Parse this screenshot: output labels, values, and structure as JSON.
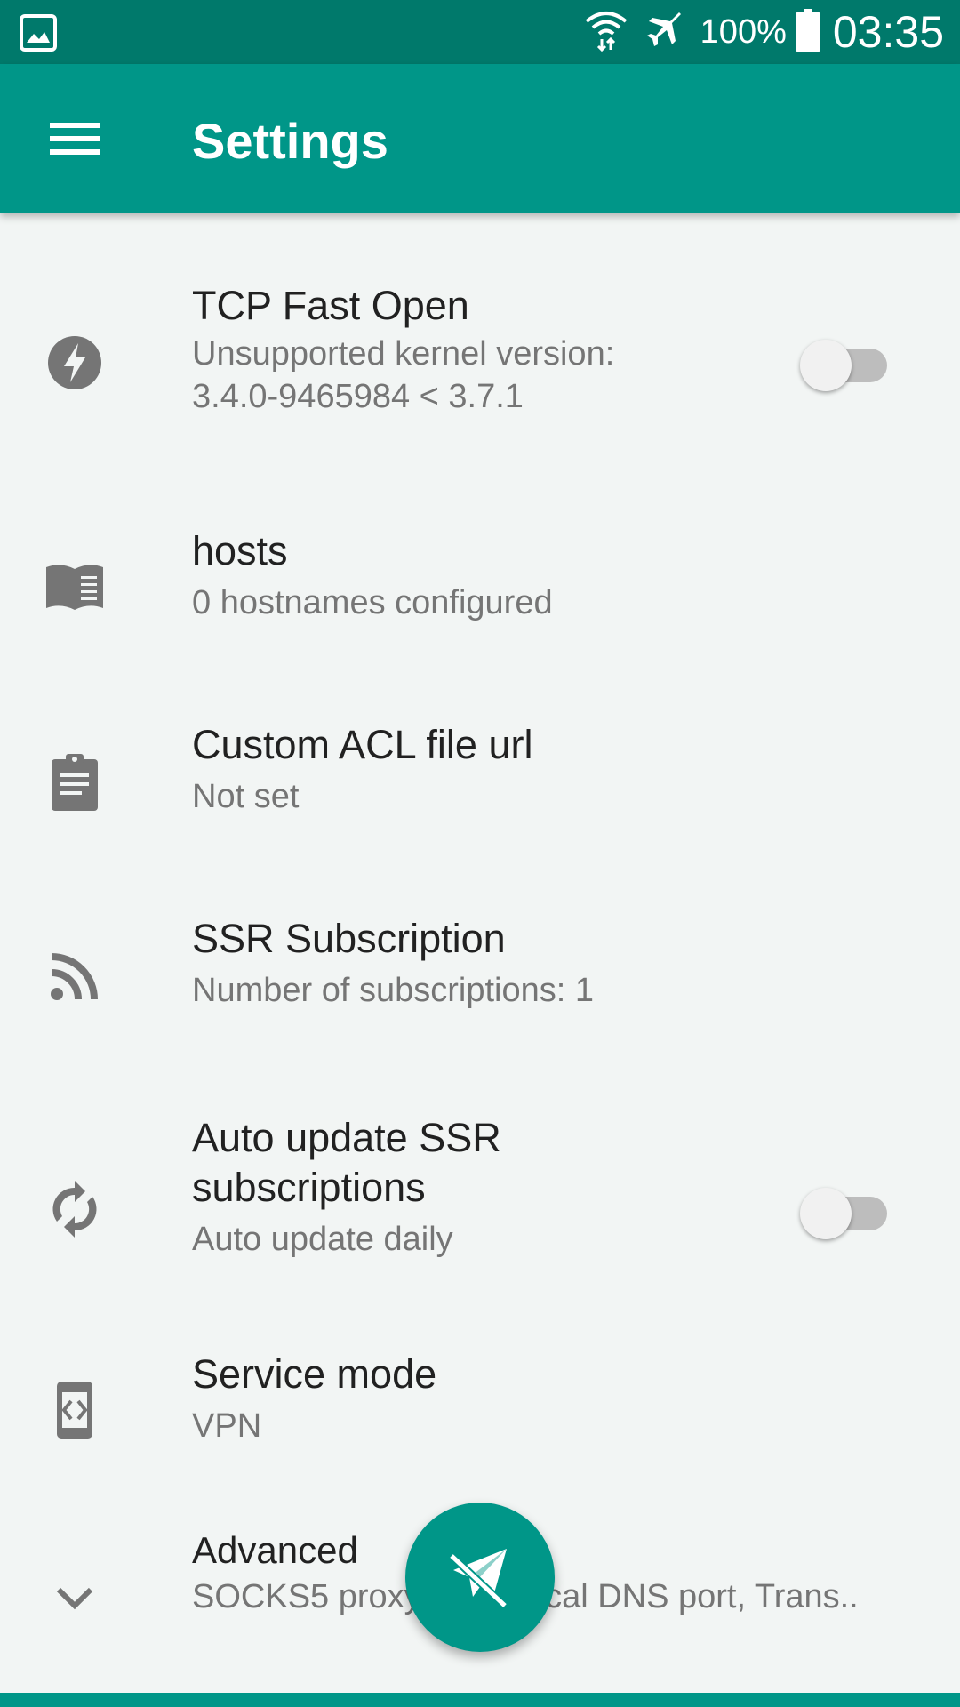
{
  "status_bar": {
    "battery": "100%",
    "time": "03:35",
    "icons": [
      "image-icon",
      "wifi-icon",
      "airplane-icon",
      "battery-icon"
    ]
  },
  "app_bar": {
    "title": "Settings",
    "menu_icon": "menu-icon"
  },
  "settings": {
    "tcp_fast_open": {
      "title": "TCP Fast Open",
      "summary_line1": "Unsupported kernel version:",
      "summary_line2": "3.4.0-9465984 < 3.7.1",
      "icon": "flash-icon",
      "enabled": false
    },
    "hosts": {
      "title": "hosts",
      "summary": "0 hostnames configured",
      "icon": "book-icon"
    },
    "custom_acl": {
      "title": "Custom ACL file url",
      "summary": "Not set",
      "icon": "clipboard-icon"
    },
    "ssr_subscription": {
      "title": "SSR Subscription",
      "summary": "Number of subscriptions: 1",
      "icon": "rss-icon"
    },
    "auto_update": {
      "title_line1": "Auto update SSR",
      "title_line2": "subscriptions",
      "summary": "Auto update daily",
      "icon": "sync-icon",
      "enabled": false
    },
    "service_mode": {
      "title": "Service mode",
      "summary": "VPN",
      "icon": "phone-code-icon"
    },
    "advanced": {
      "title": "Advanced",
      "summary": "SOCKS5 proxy port, Local DNS port, Trans..",
      "icon": "chevron-down-icon"
    }
  },
  "fab": {
    "icon": "airplane-off-icon"
  },
  "colors": {
    "primary": "#009688",
    "primary_dark": "#00796b",
    "background": "#f2f5f4",
    "icon_grey": "#757575"
  }
}
